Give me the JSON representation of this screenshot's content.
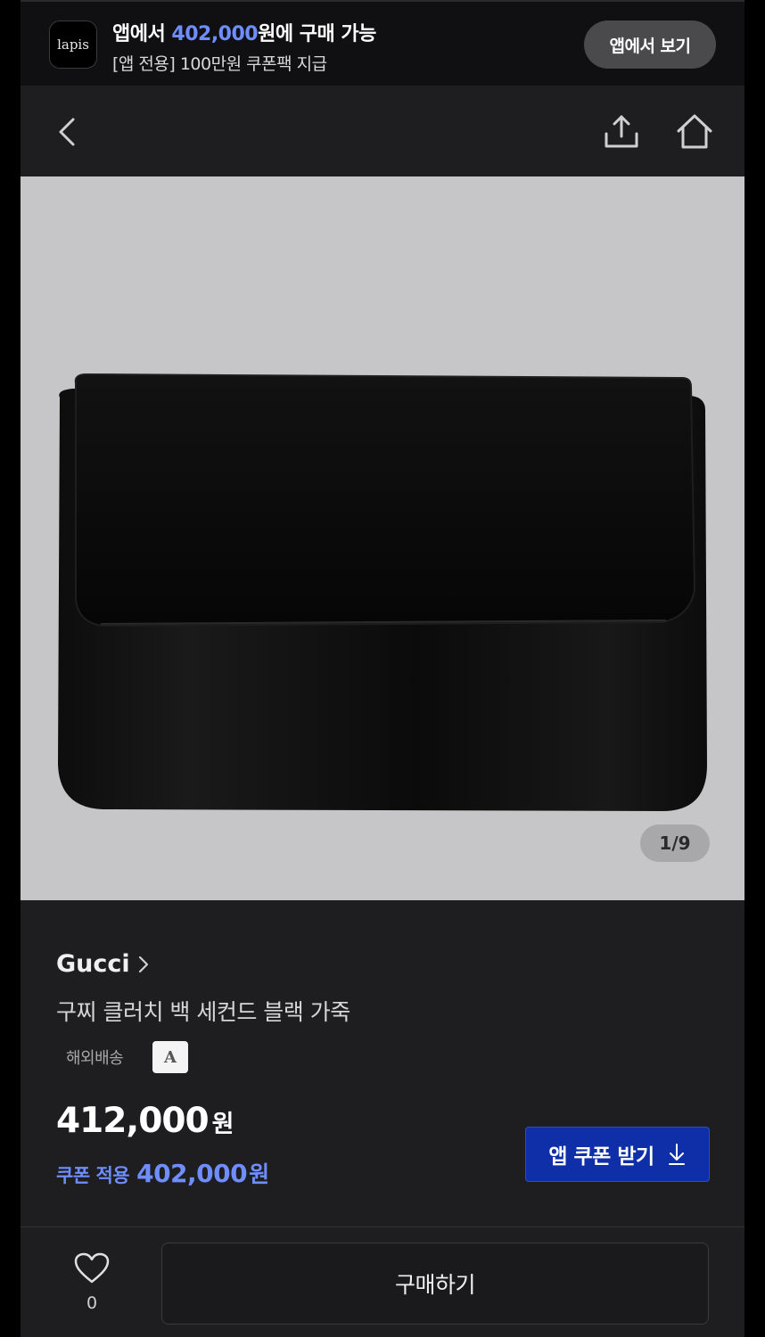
{
  "banner": {
    "logo_text": "lapis",
    "title_prefix": "앱에서 ",
    "title_price": "402,000",
    "title_suffix": "원에 구매 가능",
    "subtitle": "[앱 전용] 100만원 쿠폰팩 지급",
    "open_app_label": "앱에서 보기"
  },
  "nav": {
    "back_icon": "chevron-left-icon",
    "share_icon": "share-icon",
    "home_icon": "home-icon"
  },
  "gallery": {
    "pager": "1/9"
  },
  "product": {
    "brand": "Gucci",
    "name": "구찌 클러치 백 세컨드 블랙 가죽",
    "shipping": "해외배송",
    "grade": "A",
    "price": "412,000",
    "price_unit": "원",
    "coupon_label": "쿠폰 적용",
    "coupon_price": "402,000",
    "coupon_unit": "원",
    "coupon_button": "앱 쿠폰 받기"
  },
  "bottom": {
    "like_count": "0",
    "buy_label": "구매하기"
  },
  "colors": {
    "accent": "#6f8dff",
    "coupon_button_bg": "#0f2fa8",
    "background": "#1e1e20"
  }
}
